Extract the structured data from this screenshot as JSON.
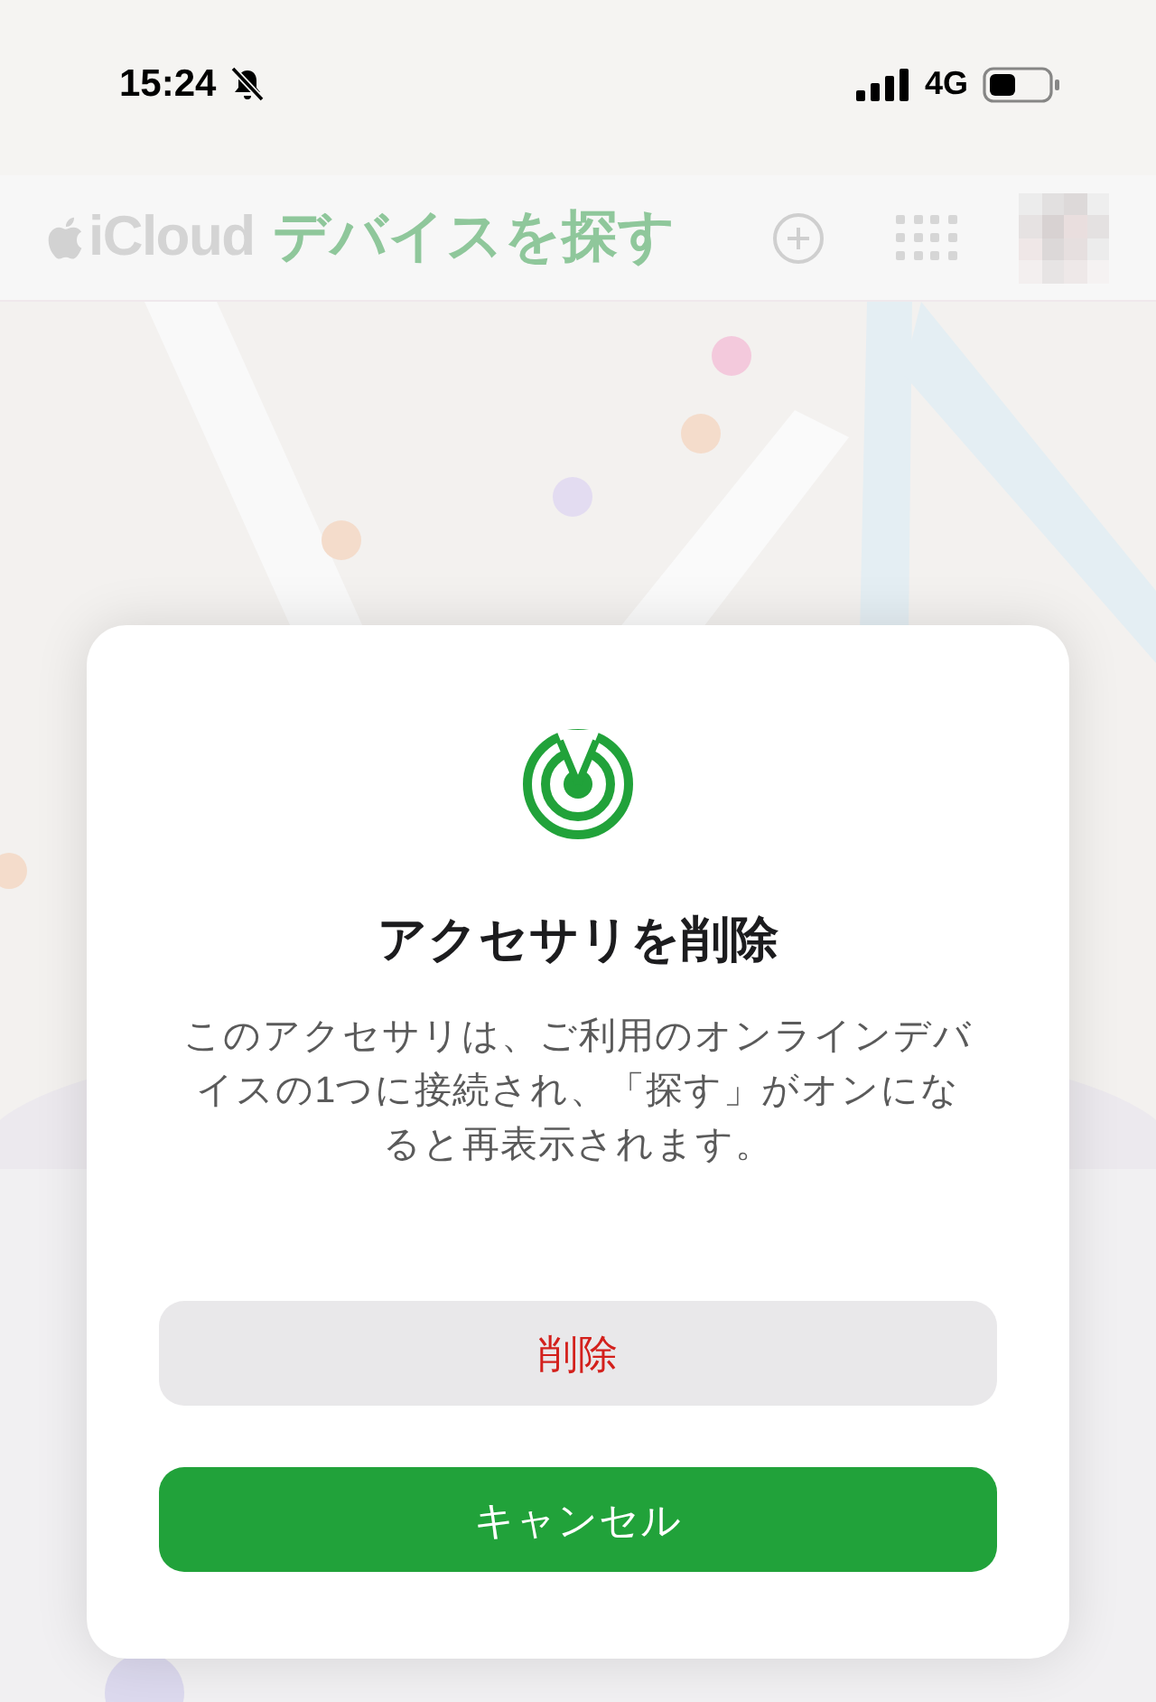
{
  "status_bar": {
    "time": "15:24",
    "silent": true,
    "network": "4G"
  },
  "header": {
    "brand": "iCloud",
    "app_title": "デバイスを探す"
  },
  "dialog": {
    "title": "アクセサリを削除",
    "message": "このアクセサリは、ご利用のオンラインデバイスの1つに接続され、「探す」がオンになると再表示されます。",
    "buttons": [
      {
        "label": "削除",
        "kind": "destructive"
      },
      {
        "label": "キャンセル",
        "kind": "primary"
      }
    ]
  }
}
